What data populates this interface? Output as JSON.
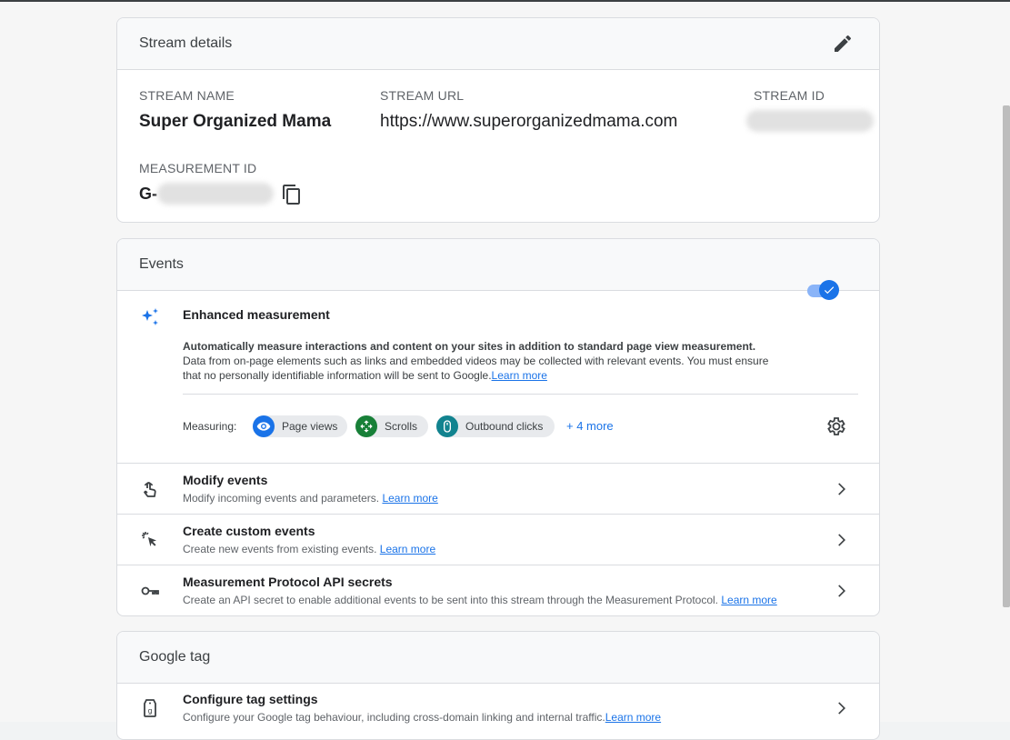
{
  "stream_details": {
    "title": "Stream details",
    "stream_name_label": "STREAM NAME",
    "stream_name_value": "Super Organized Mama",
    "stream_url_label": "STREAM URL",
    "stream_url_value": "https://www.superorganizedmama.com",
    "stream_id_label": "STREAM ID",
    "measurement_id_label": "MEASUREMENT ID",
    "measurement_id_prefix": "G-"
  },
  "events": {
    "title": "Events",
    "enhanced": {
      "title": "Enhanced measurement",
      "desc_bold": "Automatically measure interactions and content on your sites in addition to standard page view measurement.",
      "desc_line2": "Data from on-page elements such as links and embedded videos may be collected with relevant events. You must ensure",
      "desc_line3": "that no personally identifiable information will be sent to Google.",
      "learn_more": "Learn more",
      "measuring_label": "Measuring:",
      "chips": [
        "Page views",
        "Scrolls",
        "Outbound clicks"
      ],
      "more": "+ 4 more",
      "enabled": true
    },
    "rows": [
      {
        "title": "Modify events",
        "sub": "Modify incoming events and parameters.",
        "link": "Learn more"
      },
      {
        "title": "Create custom events",
        "sub": "Create new events from existing events.",
        "link": "Learn more"
      },
      {
        "title": "Measurement Protocol API secrets",
        "sub": "Create an API secret to enable additional events to be sent into this stream through the Measurement Protocol.",
        "link": "Learn more"
      }
    ]
  },
  "google_tag": {
    "title": "Google tag",
    "row": {
      "title": "Configure tag settings",
      "sub": "Configure your Google tag behaviour, including cross-domain linking and internal traffic.",
      "link": "Learn more"
    }
  },
  "colors": {
    "accent": "#1a73e8",
    "chip_pageviews": "#1a73e8",
    "chip_scrolls": "#188038",
    "chip_outbound": "#129eaf"
  }
}
